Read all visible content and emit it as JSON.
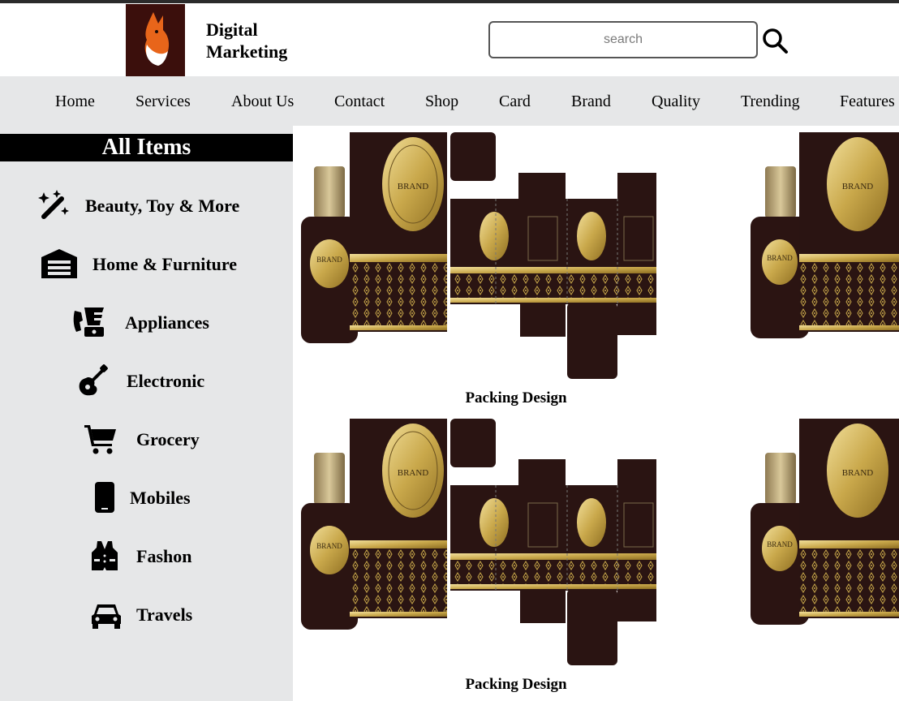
{
  "header": {
    "brand_line1": "Digital",
    "brand_line2": "Marketing",
    "search_placeholder": "search",
    "search_icon": "search-icon",
    "logo_icon": "fox-logo"
  },
  "nav": {
    "items": [
      "Home",
      "Services",
      "About Us",
      "Contact",
      "Shop",
      "Card",
      "Brand",
      "Quality",
      "Trending",
      "Features"
    ]
  },
  "sidebar": {
    "title": "All Items",
    "categories": [
      {
        "label": "Beauty, Toy & More",
        "icon": "magic-wand-icon"
      },
      {
        "label": "Home & Furniture",
        "icon": "warehouse-icon"
      },
      {
        "label": "Appliances",
        "icon": "blender-phone-icon"
      },
      {
        "label": "Electronic",
        "icon": "guitar-icon"
      },
      {
        "label": "Grocery",
        "icon": "shopping-cart-icon"
      },
      {
        "label": "Mobiles",
        "icon": "mobile-icon"
      },
      {
        "label": "Fashon",
        "icon": "vest-icon"
      },
      {
        "label": "Travels",
        "icon": "car-icon"
      }
    ]
  },
  "products": [
    {
      "caption": "Packing Design"
    },
    {
      "caption": "Packing Design"
    }
  ],
  "colors": {
    "nav_bg": "#e6e7e8",
    "sidebar_title_bg": "#000000",
    "box_dark": "#2a1412",
    "gold": "#c8a84a"
  }
}
